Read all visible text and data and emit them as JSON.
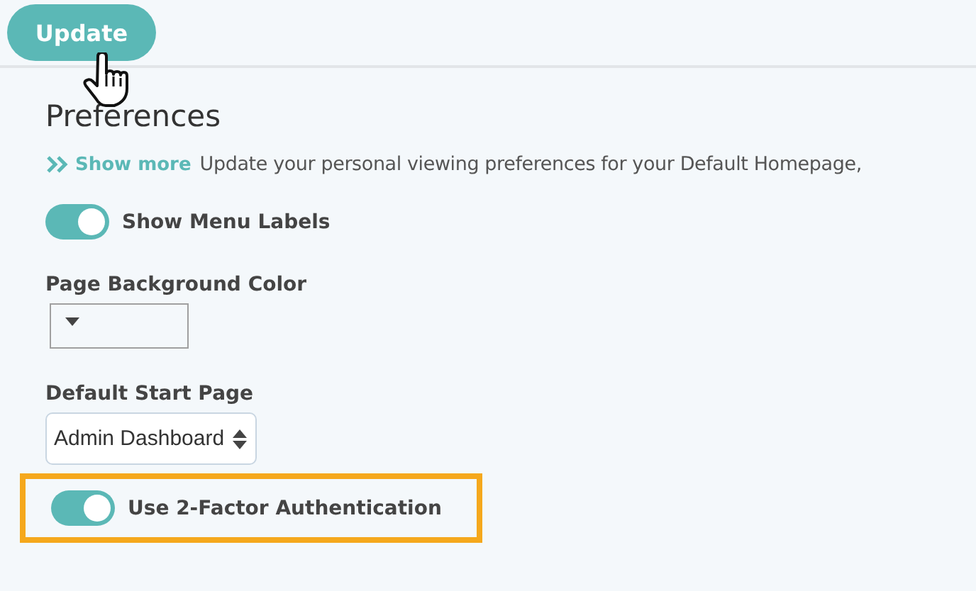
{
  "update_button": {
    "label": "Update"
  },
  "section": {
    "title": "Preferences",
    "show_more": "Show more",
    "description": "Update your personal viewing preferences for your Default Homepage,"
  },
  "settings": [
    {
      "kind": "toggle",
      "label": "Show Menu Labels",
      "on": true,
      "highlighted": false
    },
    {
      "kind": "color",
      "label": "Page Background Color"
    },
    {
      "kind": "select",
      "label": "Default Start Page",
      "value": "Admin Dashboard"
    },
    {
      "kind": "toggle",
      "label": "Use 2-Factor Authentication",
      "on": true,
      "highlighted": true
    }
  ]
}
